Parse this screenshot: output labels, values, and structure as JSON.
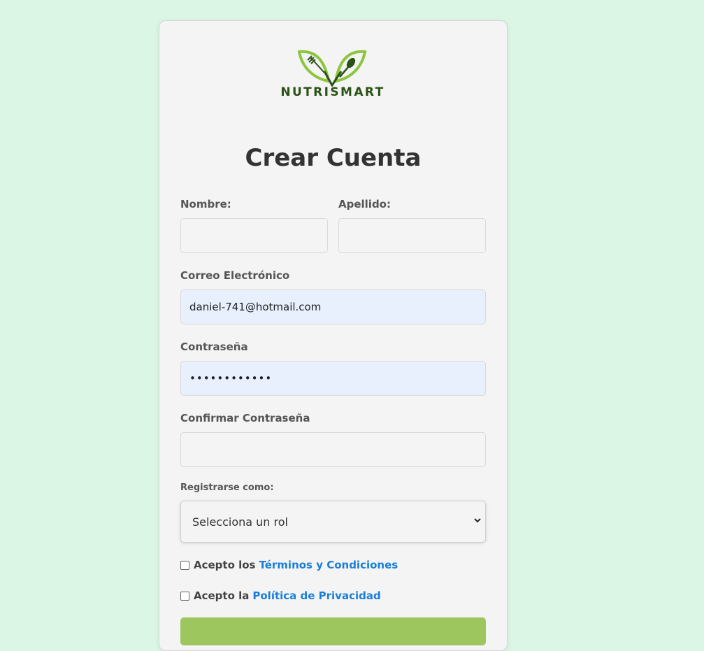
{
  "brand": {
    "name": "NUTRISMART",
    "colors": {
      "leaf": "#8cc63f",
      "text": "#2a5215",
      "link": "#1a7fd8",
      "button": "#9dc65f"
    }
  },
  "form": {
    "title": "Crear Cuenta",
    "nombre": {
      "label": "Nombre:",
      "value": ""
    },
    "apellido": {
      "label": "Apellido:",
      "value": ""
    },
    "email": {
      "label": "Correo Electrónico",
      "value": "daniel-741@hotmail.com"
    },
    "password": {
      "label": "Contraseña",
      "value": "••••••••••••"
    },
    "confirm_password": {
      "label": "Confirmar Contraseña",
      "value": ""
    },
    "role": {
      "label": "Registrarse como:",
      "selected": "Selecciona un rol"
    },
    "terms": {
      "prefix": "Acepto los",
      "link": "Términos y Condiciones"
    },
    "privacy": {
      "prefix": "Acepto la",
      "link": "Política de Privacidad"
    }
  },
  "icons": [
    "fork-icon",
    "spoon-icon",
    "leaf-icon",
    "chevron-down-icon"
  ]
}
